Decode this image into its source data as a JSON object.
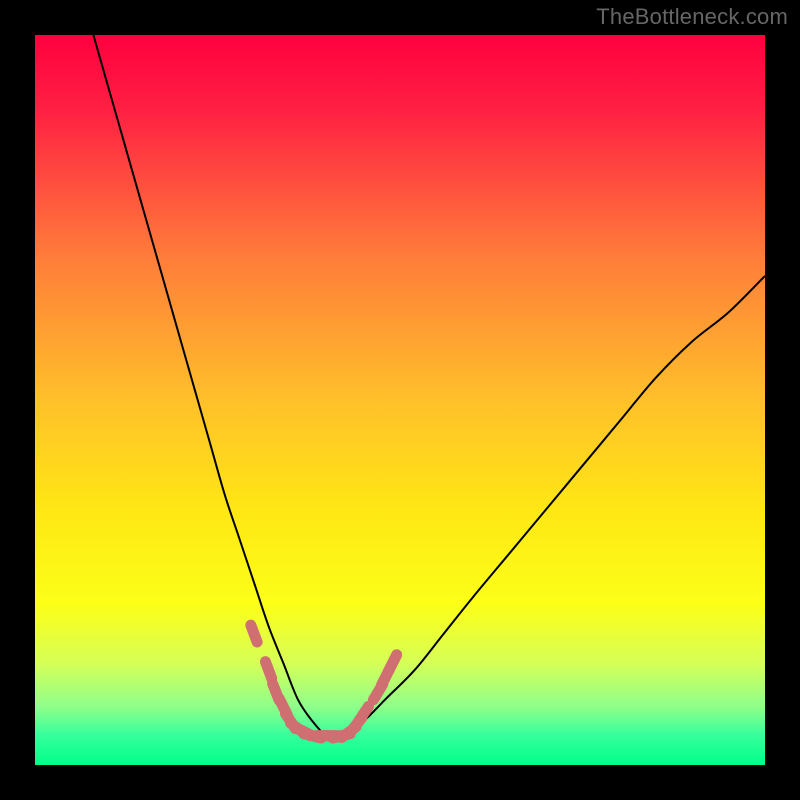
{
  "watermark": "TheBottleneck.com",
  "chart_data": {
    "type": "line",
    "title": "",
    "xlabel": "",
    "ylabel": "",
    "xlim": [
      0,
      100
    ],
    "ylim": [
      0,
      100
    ],
    "grid": false,
    "legend": false,
    "background": {
      "type": "vertical-gradient",
      "stops": [
        {
          "pos": 0.0,
          "color": "#ff003f"
        },
        {
          "pos": 0.1,
          "color": "#ff1f43"
        },
        {
          "pos": 0.3,
          "color": "#ff7b3a"
        },
        {
          "pos": 0.5,
          "color": "#ffc02a"
        },
        {
          "pos": 0.65,
          "color": "#ffe714"
        },
        {
          "pos": 0.78,
          "color": "#fcff18"
        },
        {
          "pos": 0.86,
          "color": "#d6ff57"
        },
        {
          "pos": 0.92,
          "color": "#8fff8a"
        },
        {
          "pos": 0.96,
          "color": "#34ff9c"
        },
        {
          "pos": 1.0,
          "color": "#00ff88"
        }
      ]
    },
    "series": [
      {
        "name": "bottleneck-curve",
        "color": "#000000",
        "x": [
          8,
          10,
          12,
          14,
          16,
          18,
          20,
          22,
          24,
          26,
          28,
          30,
          32,
          34,
          36,
          38,
          40,
          42,
          45,
          48,
          52,
          56,
          60,
          65,
          70,
          75,
          80,
          85,
          90,
          95,
          100
        ],
        "y": [
          100,
          93,
          86,
          79,
          72,
          65,
          58,
          51,
          44,
          37,
          31,
          25,
          19,
          14,
          9,
          6,
          4,
          4,
          6,
          9,
          13,
          18,
          23,
          29,
          35,
          41,
          47,
          53,
          58,
          62,
          67
        ]
      }
    ],
    "highlight": {
      "name": "optimal-zone-markers",
      "color": "#cf6f72",
      "stroke_width": 11,
      "x": [
        30,
        32,
        33,
        34,
        35,
        36,
        37,
        38,
        39,
        40,
        41,
        42,
        43,
        44,
        45,
        47,
        48,
        49
      ],
      "y": [
        18,
        13,
        10,
        8,
        6,
        5,
        4.5,
        4,
        4,
        4,
        4,
        4,
        4.5,
        5.5,
        7,
        10,
        12,
        14
      ]
    }
  }
}
